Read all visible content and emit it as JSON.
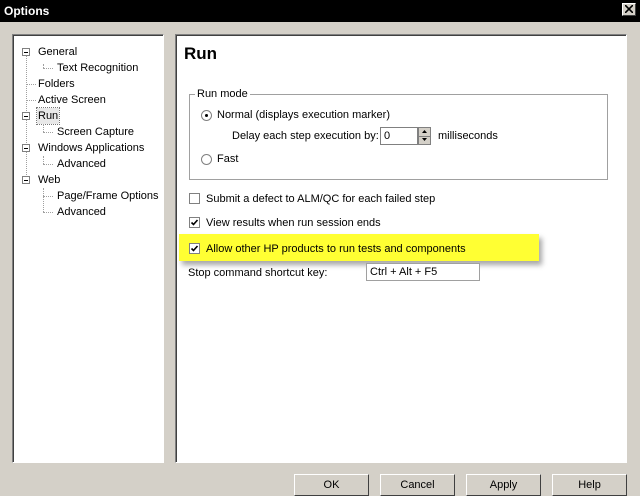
{
  "window": {
    "title": "Options"
  },
  "tree": {
    "items": [
      {
        "label": "General",
        "level": 0,
        "expanded": true
      },
      {
        "label": "Text Recognition",
        "level": 1
      },
      {
        "label": "Folders",
        "level": 0
      },
      {
        "label": "Active Screen",
        "level": 0
      },
      {
        "label": "Run",
        "level": 0,
        "expanded": true,
        "selected": true
      },
      {
        "label": "Screen Capture",
        "level": 1
      },
      {
        "label": "Windows Applications",
        "level": 0,
        "expanded": true
      },
      {
        "label": "Advanced",
        "level": 1
      },
      {
        "label": "Web",
        "level": 0,
        "expanded": true
      },
      {
        "label": "Page/Frame Options",
        "level": 1
      },
      {
        "label": "Advanced",
        "level": 1
      }
    ]
  },
  "panel": {
    "title": "Run",
    "run_mode": {
      "legend": "Run mode",
      "normal_label": "Normal (displays execution marker)",
      "normal_selected": true,
      "delay_label": "Delay each step execution by:",
      "delay_value": "0",
      "delay_unit": "milliseconds",
      "fast_label": "Fast",
      "fast_selected": false
    },
    "options": [
      {
        "label": "Submit a defect to ALM/QC for each failed step",
        "checked": false
      },
      {
        "label": "View results when run session ends",
        "checked": true
      },
      {
        "label": "Allow other HP products to run tests and components",
        "checked": true,
        "highlighted": true
      }
    ],
    "shortcut": {
      "label": "Stop command shortcut key:",
      "value": "Ctrl + Alt + F5"
    }
  },
  "buttons": {
    "ok": "OK",
    "cancel": "Cancel",
    "apply": "Apply",
    "help": "Help"
  },
  "colors": {
    "highlight": "#ffff33",
    "titlebar": "#000000",
    "dialog_bg": "#d4d0c8"
  }
}
